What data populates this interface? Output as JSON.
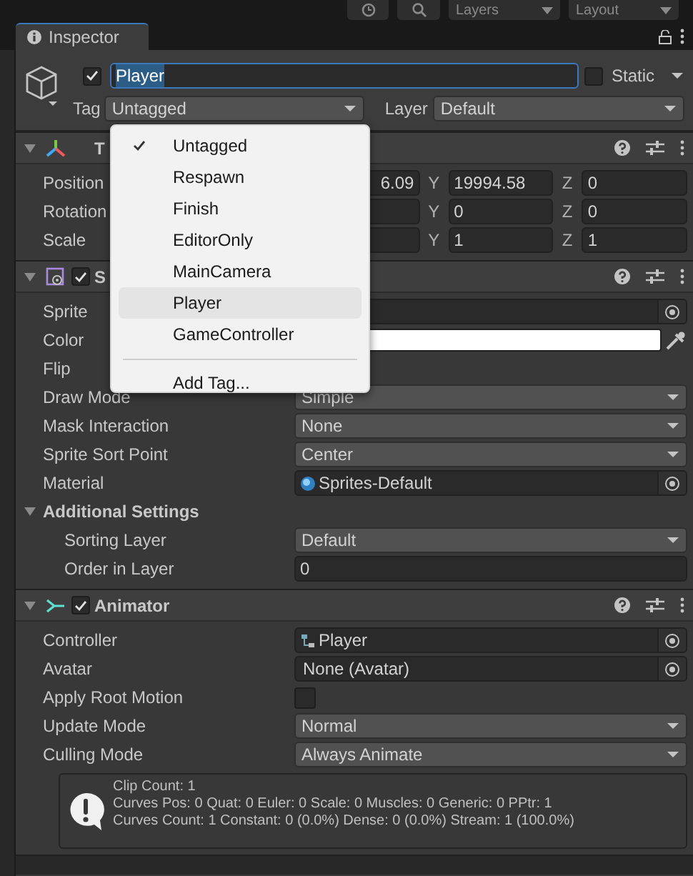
{
  "toolbar": {
    "dropdowns": [
      "Layers",
      "Layout"
    ]
  },
  "tab": {
    "title": "Inspector",
    "selected": true
  },
  "object": {
    "active": true,
    "name": "Player",
    "name_selected": true,
    "static": false,
    "static_label": "Static",
    "tag_label": "Tag",
    "tag": "Untagged",
    "layer_label": "Layer",
    "layer": "Default"
  },
  "components": [
    {
      "kind": "transform",
      "title": "T",
      "expanded": true,
      "rows": [
        {
          "kind": "vector",
          "label": "Position",
          "fields": [
            {
              "value": "6.09"
            },
            {
              "axis": "Y",
              "value": "19994.58"
            },
            {
              "axis": "Z",
              "value": "0"
            }
          ]
        },
        {
          "kind": "vector",
          "label": "Rotation",
          "fields": [
            {
              "axis": "Y",
              "value": "0"
            },
            {
              "axis": "Z",
              "value": "0"
            }
          ]
        },
        {
          "kind": "vector",
          "label": "Scale",
          "fields": [
            {
              "axis": "Y",
              "value": "1"
            },
            {
              "axis": "Z",
              "value": "1"
            }
          ]
        }
      ]
    },
    {
      "kind": "sprite_renderer",
      "title": "S",
      "enabled": true,
      "expanded": true,
      "rows": [
        {
          "kind": "object",
          "label": "Sprite"
        },
        {
          "kind": "color",
          "label": "Color",
          "color": "#ffffff"
        },
        {
          "kind": "empty",
          "label": "Flip"
        },
        {
          "kind": "dropdown",
          "label": "Draw Mode",
          "value": "Simple"
        },
        {
          "kind": "dropdown",
          "label": "Mask Interaction",
          "value": "None"
        },
        {
          "kind": "dropdown",
          "label": "Sprite Sort Point",
          "value": "Center"
        },
        {
          "kind": "material",
          "label": "Material",
          "value": "Sprites-Default"
        },
        {
          "kind": "foldout",
          "label": "Additional Settings",
          "expanded": true,
          "children": [
            {
              "kind": "dropdown",
              "label": "Sorting Layer",
              "value": "Default"
            },
            {
              "kind": "int",
              "label": "Order in Layer",
              "value": "0"
            }
          ]
        }
      ]
    },
    {
      "kind": "animator",
      "title": "Animator",
      "enabled": true,
      "expanded": true,
      "rows": [
        {
          "kind": "controller",
          "label": "Controller",
          "value": "Player"
        },
        {
          "kind": "object",
          "label": "Avatar",
          "value": "None (Avatar)"
        },
        {
          "kind": "checkbox",
          "label": "Apply Root Motion",
          "checked": false
        },
        {
          "kind": "dropdown",
          "label": "Update Mode",
          "value": "Normal"
        },
        {
          "kind": "dropdown",
          "label": "Culling Mode",
          "value": "Always Animate"
        }
      ],
      "help": {
        "lines": [
          "Clip Count: 1",
          "Curves Pos: 0 Quat: 0 Euler: 0 Scale: 0 Muscles: 0 Generic: 0 PPtr: 1",
          "Curves Count: 1 Constant: 0 (0.0%) Dense: 0 (0.0%) Stream: 1 (100.0%)"
        ]
      }
    }
  ],
  "tag_menu": {
    "items": [
      {
        "label": "Untagged",
        "checked": true,
        "selected": false
      },
      {
        "label": "Respawn",
        "checked": false,
        "selected": false
      },
      {
        "label": "Finish",
        "checked": false,
        "selected": false
      },
      {
        "label": "EditorOnly",
        "checked": false,
        "selected": false
      },
      {
        "label": "MainCamera",
        "checked": false,
        "selected": false
      },
      {
        "label": "Player",
        "checked": false,
        "selected": true
      },
      {
        "label": "GameController",
        "checked": false,
        "selected": false
      }
    ],
    "add_item": "Add Tag..."
  }
}
